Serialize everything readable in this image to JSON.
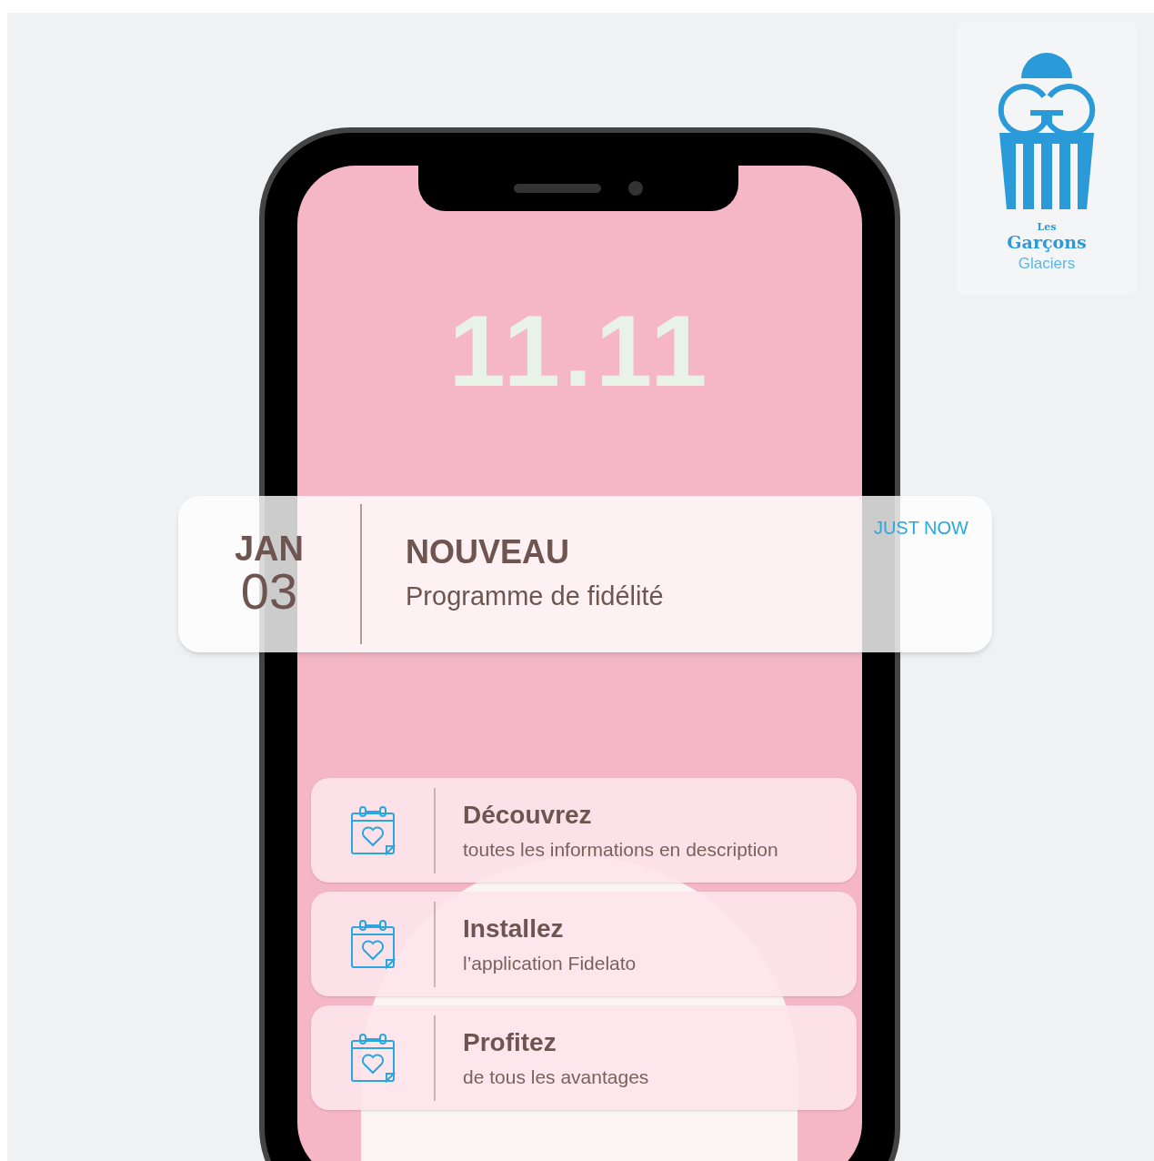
{
  "logo": {
    "lines": [
      "Les",
      "Garçons",
      "Glaciers"
    ]
  },
  "lock_screen": {
    "clock": "11.11"
  },
  "notification": {
    "month": "JAN",
    "day": "03",
    "title": "NOUVEAU",
    "body": "Programme de fidélité",
    "time": "JUST NOW"
  },
  "cards": [
    {
      "title": "Découvrez",
      "subtitle": "toutes les informations en description"
    },
    {
      "title": "Installez",
      "subtitle": "l’application Fidelato"
    },
    {
      "title": "Profitez",
      "subtitle": "de tous les avantages"
    }
  ]
}
